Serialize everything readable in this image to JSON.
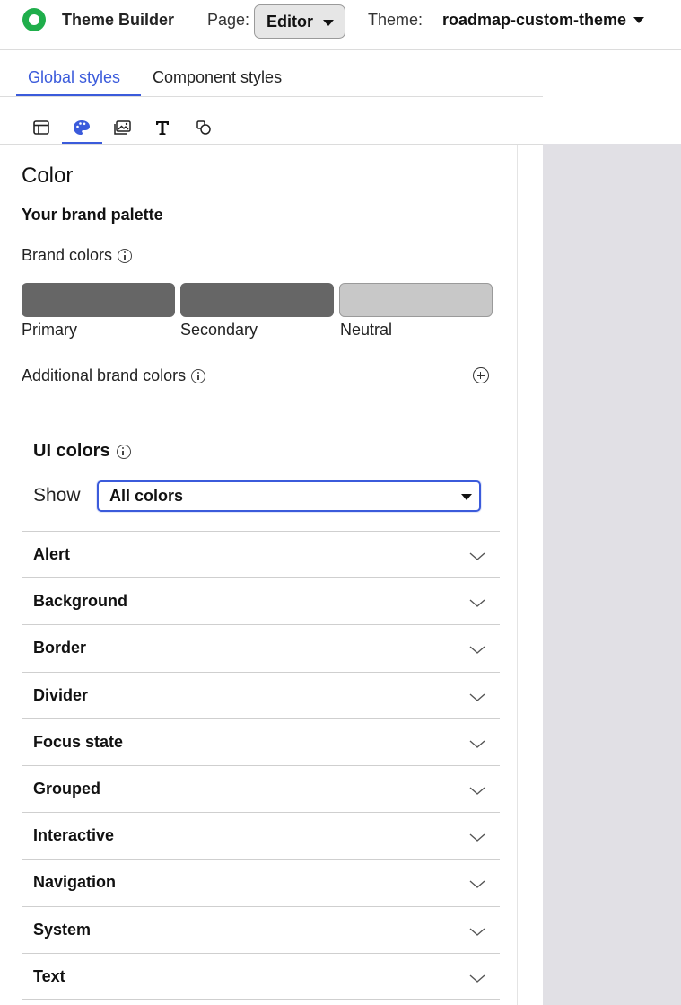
{
  "header": {
    "app_title": "Theme Builder",
    "page_label": "Page:",
    "page_value": "Editor",
    "theme_label": "Theme:",
    "theme_value": "roadmap-custom-theme"
  },
  "tabs": [
    {
      "label": "Global styles",
      "active": true
    },
    {
      "label": "Component styles",
      "active": false
    }
  ],
  "toolbar": {
    "icons": [
      "layout-icon",
      "palette-icon",
      "image-icon",
      "typography-icon",
      "shapes-icon"
    ],
    "active_icon": "palette-icon",
    "accent_color": "#3b5bdb"
  },
  "color_section": {
    "title": "Color",
    "palette_title": "Your brand palette",
    "brand_colors_label": "Brand colors",
    "swatches": [
      {
        "label": "Primary",
        "color": "#666666"
      },
      {
        "label": "Secondary",
        "color": "#666666"
      },
      {
        "label": "Neutral",
        "color": "#c8c8c8"
      }
    ],
    "additional_label": "Additional brand colors"
  },
  "ui_colors": {
    "title": "UI colors",
    "show_label": "Show",
    "show_value": "All colors",
    "categories": [
      "Alert",
      "Background",
      "Border",
      "Divider",
      "Focus state",
      "Grouped",
      "Interactive",
      "Navigation",
      "System",
      "Text"
    ]
  },
  "colors": {
    "logo": "#1fae4b",
    "accent": "#3b5bdb",
    "canvas": "#e1e0e5"
  }
}
